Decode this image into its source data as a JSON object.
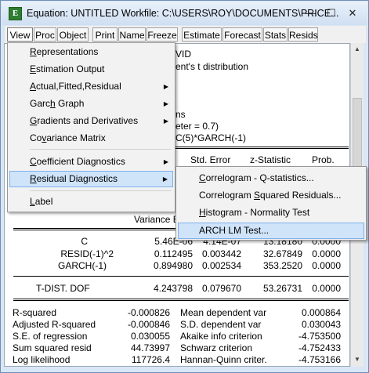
{
  "window": {
    "title": "Equation: UNTITLED   Workfile: C:\\USERS\\ROY\\DOCUMENTS\\PRICE...",
    "buttons": {
      "minimize": "—",
      "maximize": "☐",
      "close": "✕"
    }
  },
  "toolbar": {
    "buttons": [
      "View",
      "Proc",
      "Object",
      "Print",
      "Name",
      "Freeze",
      "Estimate",
      "Forecast",
      "Stats",
      "Resids"
    ]
  },
  "output": {
    "partial_lines": [
      "VID",
      "ent's t distribution",
      "ns",
      "eter = 0.7)",
      "C(5)*GARCH(-1)"
    ],
    "col_headers": {
      "stderr": "Std. Error",
      "zstat": "z-Statistic",
      "prob": "Prob."
    },
    "variance_label": "Variance E",
    "variance_rows": [
      {
        "name": "C",
        "coef": "5.46E-06",
        "se": "4.14E-07",
        "z": "13.18180",
        "p": "0.0000"
      },
      {
        "name": "RESID(-1)^2",
        "coef": "0.112495",
        "se": "0.003442",
        "z": "32.67849",
        "p": "0.0000"
      },
      {
        "name": "GARCH(-1)",
        "coef": "0.894980",
        "se": "0.002534",
        "z": "353.2520",
        "p": "0.0000"
      }
    ],
    "dof_row": {
      "name": "T-DIST. DOF",
      "coef": "4.243798",
      "se": "0.079670",
      "z": "53.26731",
      "p": "0.0000"
    },
    "stats_left": [
      {
        "label": "R-squared",
        "value": "-0.000826"
      },
      {
        "label": "Adjusted R-squared",
        "value": "-0.000846"
      },
      {
        "label": "S.E. of regression",
        "value": "0.030055"
      },
      {
        "label": "Sum squared resid",
        "value": "44.73997"
      },
      {
        "label": "Log likelihood",
        "value": "117726.4"
      }
    ],
    "stats_right": [
      {
        "label": "Mean dependent var",
        "value": "0.000864"
      },
      {
        "label": "S.D. dependent var",
        "value": "0.030043"
      },
      {
        "label": "Akaike info criterion",
        "value": "-4.753500"
      },
      {
        "label": "Schwarz criterion",
        "value": "-4.752433"
      },
      {
        "label": "Hannan-Quinn criter.",
        "value": "-4.753166"
      }
    ]
  },
  "view_menu": {
    "items": [
      {
        "pre": "",
        "key": "R",
        "post": "epresentations",
        "submenu": false
      },
      {
        "pre": "",
        "key": "E",
        "post": "stimation Output",
        "submenu": false
      },
      {
        "pre": "",
        "key": "A",
        "post": "ctual,Fitted,Residual",
        "submenu": true
      },
      {
        "pre": "Garc",
        "key": "h",
        "post": " Graph",
        "submenu": true
      },
      {
        "pre": "",
        "key": "G",
        "post": "radients and Derivatives",
        "submenu": true
      },
      {
        "pre": "Co",
        "key": "v",
        "post": "ariance Matrix",
        "submenu": false
      },
      {
        "pre": "",
        "key": "C",
        "post": "oefficient Diagnostics",
        "submenu": true
      },
      {
        "pre": "",
        "key": "R",
        "post": "esidual Diagnostics",
        "submenu": true
      },
      {
        "pre": "",
        "key": "L",
        "post": "abel",
        "submenu": false
      }
    ]
  },
  "residual_submenu": {
    "items": [
      {
        "pre": "",
        "key": "C",
        "post": "orrelogram - Q-statistics..."
      },
      {
        "pre": "Correlogram ",
        "key": "S",
        "post": "quared Residuals..."
      },
      {
        "pre": "",
        "key": "H",
        "post": "istogram - Normality Test"
      },
      {
        "pre": "ARCH LM Test...",
        "key": "",
        "post": ""
      }
    ]
  },
  "colors": {
    "menu_highlight": "#cfe3f9",
    "title_bar": "#d9e6f5"
  }
}
